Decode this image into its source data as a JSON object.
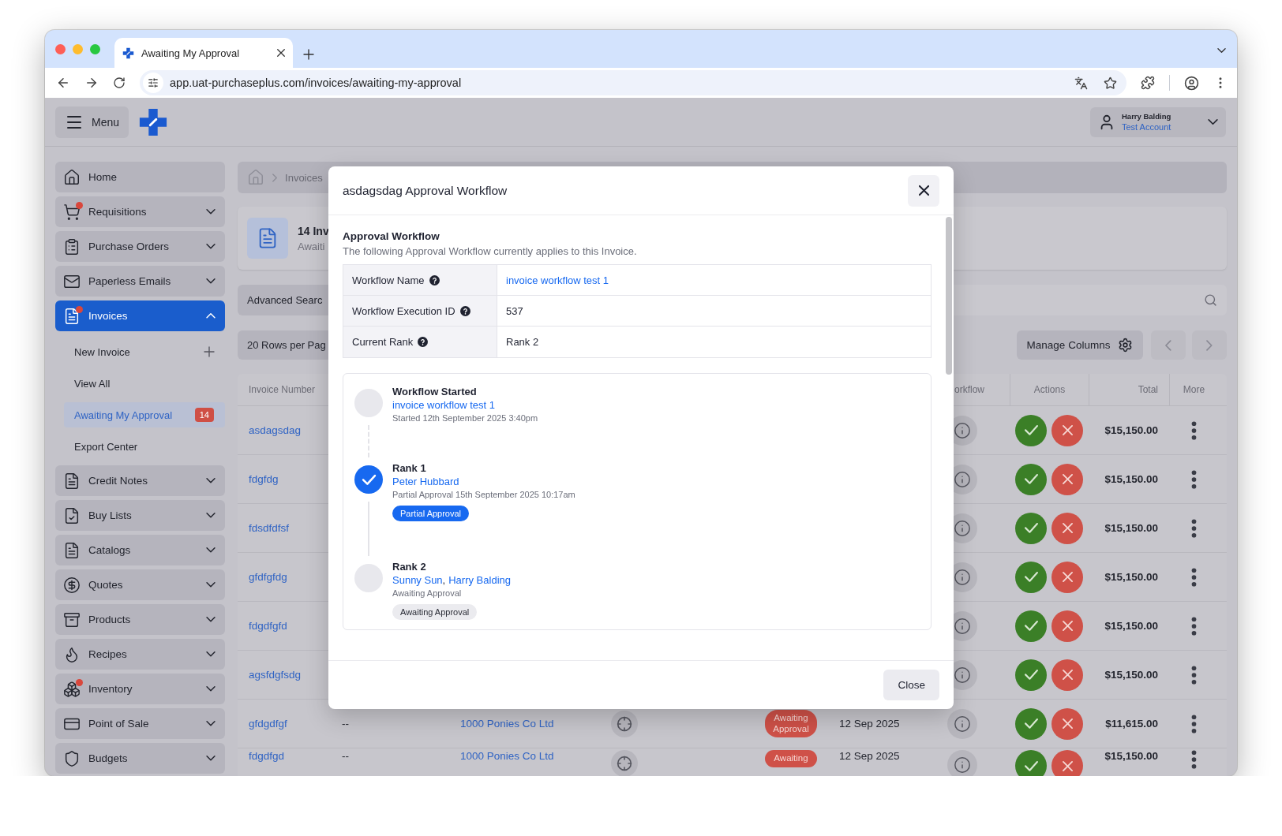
{
  "browser": {
    "tab_title": "Awaiting My Approval",
    "address": "app.uat-purchaseplus.com/invoices/awaiting-my-approval"
  },
  "header": {
    "menu_label": "Menu",
    "user": {
      "name": "Harry Balding",
      "account": "Test Account"
    }
  },
  "sidebar": {
    "items": [
      {
        "label": "Home",
        "kind": "link",
        "selected": false,
        "alert": false
      },
      {
        "label": "Requisitions",
        "kind": "group",
        "selected": false,
        "expanded": false,
        "alert": true
      },
      {
        "label": "Purchase Orders",
        "kind": "group",
        "selected": false,
        "expanded": false,
        "alert": false
      },
      {
        "label": "Paperless Emails",
        "kind": "group",
        "selected": false,
        "expanded": false,
        "alert": false
      },
      {
        "label": "Invoices",
        "kind": "group",
        "selected": true,
        "expanded": true,
        "alert": true,
        "children": [
          {
            "label": "New Invoice",
            "selected": false,
            "addable": true
          },
          {
            "label": "View All",
            "selected": false,
            "addable": false
          },
          {
            "label": "Awaiting My Approval",
            "selected": true,
            "addable": false,
            "count": "14"
          },
          {
            "label": "Export Center",
            "selected": false,
            "addable": false
          }
        ]
      },
      {
        "label": "Credit Notes",
        "kind": "group",
        "selected": false,
        "expanded": false,
        "alert": false
      },
      {
        "label": "Buy Lists",
        "kind": "group",
        "selected": false,
        "expanded": false,
        "alert": false
      },
      {
        "label": "Catalogs",
        "kind": "group",
        "selected": false,
        "expanded": false,
        "alert": false
      },
      {
        "label": "Quotes",
        "kind": "group",
        "selected": false,
        "expanded": false,
        "alert": false
      },
      {
        "label": "Products",
        "kind": "group",
        "selected": false,
        "expanded": false,
        "alert": false
      },
      {
        "label": "Recipes",
        "kind": "group",
        "selected": false,
        "expanded": false,
        "alert": false
      },
      {
        "label": "Inventory",
        "kind": "group",
        "selected": false,
        "expanded": false,
        "alert": true
      },
      {
        "label": "Point of Sale",
        "kind": "group",
        "selected": false,
        "expanded": false,
        "alert": false
      },
      {
        "label": "Budgets",
        "kind": "group",
        "selected": false,
        "expanded": false,
        "alert": false
      }
    ]
  },
  "breadcrumb": [
    "Invoices"
  ],
  "summary": {
    "title": "14 Inv",
    "subtitle": "Awaiti"
  },
  "toolbar": {
    "advanced_search": "Advanced Searc",
    "rows_per_page": "20 Rows per Pag",
    "manage_columns": "Manage Columns"
  },
  "table": {
    "columns": [
      "Invoice Number",
      "orkflow",
      "Actions",
      "Total",
      "More"
    ],
    "rows": [
      {
        "invoice_number": "asdagsdag",
        "total": "$15,150.00"
      },
      {
        "invoice_number": "fdgfdg",
        "total": "$15,150.00"
      },
      {
        "invoice_number": "fdsdfdfsf",
        "total": "$15,150.00"
      },
      {
        "invoice_number": "gfdfgfdg",
        "total": "$15,150.00"
      },
      {
        "invoice_number": "fdgdfgfd",
        "total": "$15,150.00"
      },
      {
        "invoice_number": "agsfdgfsdg",
        "total": "$15,150.00"
      },
      {
        "invoice_number": "gfdgdfgf",
        "reference": "--",
        "supplier": "1000 Ponies Co Ltd",
        "status": "Awaiting Approval",
        "date": "12 Sep 2025",
        "total": "$11,615.00"
      },
      {
        "invoice_number": "fdgdfgd",
        "reference": "--",
        "supplier": "1000 Ponies Co Ltd",
        "status": "Awaiting",
        "date": "12 Sep 2025",
        "total": "$15,150.00"
      }
    ]
  },
  "modal": {
    "title": "asdagsdag Approval Workflow",
    "heading": "Approval Workflow",
    "description": "The following Approval Workflow currently applies to this Invoice.",
    "details": [
      {
        "label": "Workflow Name",
        "value": "invoice workflow test 1",
        "kind": "link"
      },
      {
        "label": "Workflow Execution ID",
        "value": "537",
        "kind": "text"
      },
      {
        "label": "Current Rank",
        "value": "Rank 2",
        "kind": "text"
      }
    ],
    "steps": [
      {
        "title": "Workflow Started",
        "approvers": [
          {
            "name": "invoice workflow test 1"
          }
        ],
        "detail": "Started 12th September 2025 3:40pm",
        "done": false
      },
      {
        "title": "Rank 1",
        "approvers": [
          {
            "name": "Peter Hubbard"
          }
        ],
        "detail": "Partial Approval 15th September 2025 10:17am",
        "badge": {
          "text": "Partial Approval",
          "kind": "primary"
        },
        "done": true
      },
      {
        "title": "Rank 2",
        "approvers": [
          {
            "name": "Sunny Sun",
            "separator": ","
          },
          {
            "name": "Harry Balding"
          }
        ],
        "detail": "Awaiting Approval",
        "badge": {
          "text": "Awaiting Approval",
          "kind": "neutral"
        },
        "done": false
      }
    ],
    "close_label": "Close"
  }
}
